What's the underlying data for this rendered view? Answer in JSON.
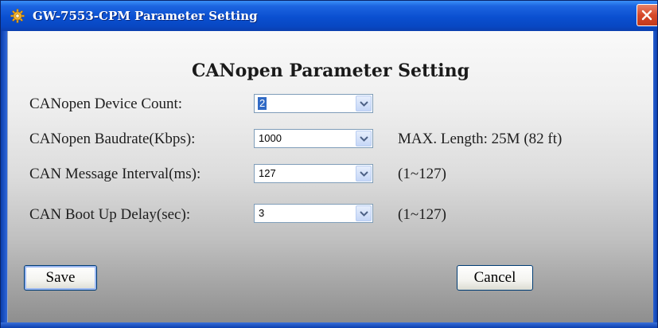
{
  "window": {
    "title": "GW-7553-CPM Parameter Setting",
    "icon": "gear-icon",
    "close_icon": "close-icon"
  },
  "form": {
    "heading": "CANopen Parameter Setting",
    "rows": [
      {
        "label": "CANopen Device Count:",
        "value": "2",
        "hint": ""
      },
      {
        "label": "CANopen Baudrate(Kbps):",
        "value": "1000",
        "hint": "MAX. Length: 25M (82 ft)"
      },
      {
        "label": "CAN Message Interval(ms):",
        "value": "127",
        "hint": "(1~127)"
      },
      {
        "label": "CAN Boot Up Delay(sec):",
        "value": "3",
        "hint": "(1~127)"
      }
    ]
  },
  "buttons": {
    "save_label": "Save",
    "cancel_label": "Cancel"
  },
  "colors": {
    "titlebar": "#0a4fd0",
    "selection": "#316ac5",
    "close": "#d6482a"
  }
}
